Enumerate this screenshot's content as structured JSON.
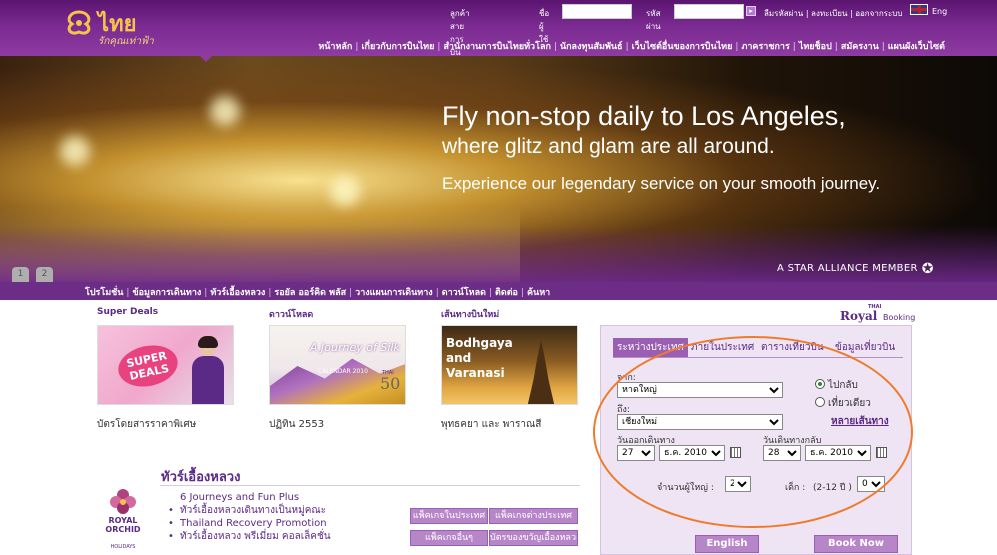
{
  "brand": {
    "name": "ไทย",
    "tagline": "รักคุณเท่าฟ้า",
    "brand_color": "#6b2d86",
    "accent_gold": "#f7c44a"
  },
  "login": {
    "member_label": "ลูกค้าสายการบิน Login",
    "user_label": "ชื่อผู้ใช้",
    "pass_label": "รหัสผ่าน",
    "links": "ลืมรหัสผ่าน | ลงทะเบียน | ออกจากระบบ",
    "lang": "Eng"
  },
  "topnav": [
    "หน้าหลัก",
    "เกี่ยวกับการบินไทย",
    "สำนักงานการบินไทยทั่วโลก",
    "นักลงทุนสัมพันธ์",
    "เว็บไซต์อื่นของการบินไทย",
    "ภาคราชการ",
    "ไทยช็อป",
    "สมัครงาน",
    "แผนผังเว็บไซต์"
  ],
  "banner": {
    "line1": "Fly non-stop daily to Los Angeles,",
    "line2": "where glitz and glam are all around.",
    "line3": "Experience our legendary service on your smooth journey.",
    "star_alliance": "A STAR ALLIANCE MEMBER",
    "slides": [
      "1",
      "2"
    ]
  },
  "subnav": [
    "โปรโมชั่น",
    "ข้อมูลการเดินทาง",
    "ทัวร์เอื้องหลวง",
    "รอยัล ออร์คิด พลัส",
    "วางแผนการเดินทาง",
    "ดาวน์โหลด",
    "ติดต่อ",
    "ค้นหา"
  ],
  "promos": [
    {
      "title": "Super Deals",
      "caption": "บัตรโดยสารราคาพิเศษ",
      "badge": "SUPER DEALS"
    },
    {
      "title": "ดาวน์โหลด",
      "caption": "ปฏิทิน 2553",
      "image_text": "A Journey of Silk",
      "image_sub": "CALENDAR 2010",
      "badge": "50",
      "badge_brand": "THAI"
    },
    {
      "title": "เส้นทางบินใหม่",
      "caption": "พุทธคยา และ พาราณสี",
      "image_text": "Bodhgaya and Varanasi"
    }
  ],
  "holidays": {
    "title": "ทัวร์เอื้องหลวง",
    "logo_text": "ROYAL ORCHID",
    "logo_sub": "HOLIDAYS",
    "items": [
      "6 Journeys and Fun Plus",
      "ทัวร์เอื้องหลวงเดินทางเป็นหมู่คณะ",
      "Thailand Recovery Promotion",
      "ทัวร์เอื้องหลวง พรีเมี่ยม คอลเล็คชั่น"
    ],
    "buttons": [
      "แพ็คเกจในประเทศ",
      "แพ็คเกจต่างประเทศ",
      "แพ็คเกจอื่นๆ",
      "บัตรของขวัญเอื้องหลวง"
    ]
  },
  "booking": {
    "logo_brand": "THAI",
    "logo_royal": "Royal",
    "logo_booking": "Booking",
    "tabs": [
      "ระหว่างประเทศ",
      "ภายในประเทศ",
      "ตารางเที่ยวบิน",
      "ข้อมูลเที่ยวบิน"
    ],
    "from_label": "จาก:",
    "from_value": "หาดใหญ่",
    "to_label": "ถึง:",
    "to_value": "เชียงใหม่",
    "depart_label": "วันออกเดินทาง",
    "return_label": "วันเดินทางกลับ",
    "depart_day": "27",
    "depart_month": "ธ.ค. 2010",
    "return_day": "28",
    "return_month": "ธ.ค. 2010",
    "trip_roundtrip": "ไปกลับ",
    "trip_oneway": "เที่ยวเดียว",
    "trip_multi": "หลายเส้นทาง",
    "adults_label": "จำนวนผู้ใหญ่ :",
    "adults_value": "2",
    "children_label": "เด็ก :",
    "children_age": "(2-12 ปี )",
    "children_value": "0",
    "english_button": "English",
    "book_button": "Book Now"
  }
}
